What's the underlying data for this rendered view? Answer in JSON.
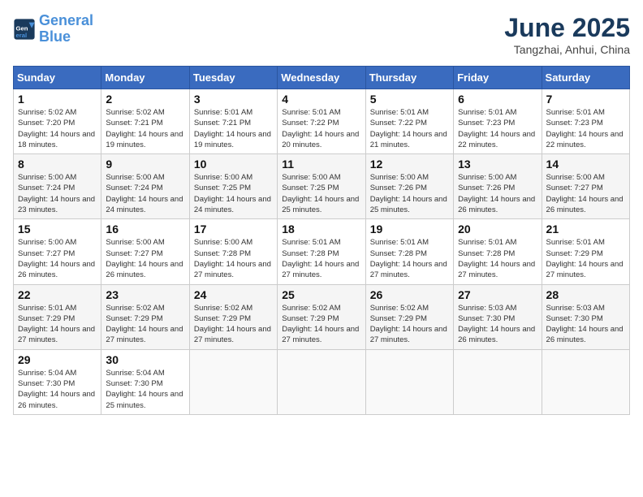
{
  "header": {
    "logo_line1": "General",
    "logo_line2": "Blue",
    "title": "June 2025",
    "subtitle": "Tangzhai, Anhui, China"
  },
  "calendar": {
    "days_of_week": [
      "Sunday",
      "Monday",
      "Tuesday",
      "Wednesday",
      "Thursday",
      "Friday",
      "Saturday"
    ],
    "weeks": [
      [
        {
          "day": null
        },
        {
          "day": "2",
          "sunrise": "5:02 AM",
          "sunset": "7:21 PM",
          "daylight": "14 hours and 19 minutes."
        },
        {
          "day": "3",
          "sunrise": "5:01 AM",
          "sunset": "7:21 PM",
          "daylight": "14 hours and 19 minutes."
        },
        {
          "day": "4",
          "sunrise": "5:01 AM",
          "sunset": "7:22 PM",
          "daylight": "14 hours and 20 minutes."
        },
        {
          "day": "5",
          "sunrise": "5:01 AM",
          "sunset": "7:22 PM",
          "daylight": "14 hours and 21 minutes."
        },
        {
          "day": "6",
          "sunrise": "5:01 AM",
          "sunset": "7:23 PM",
          "daylight": "14 hours and 22 minutes."
        },
        {
          "day": "7",
          "sunrise": "5:01 AM",
          "sunset": "7:23 PM",
          "daylight": "14 hours and 22 minutes."
        }
      ],
      [
        {
          "day": "1",
          "sunrise": "5:02 AM",
          "sunset": "7:20 PM",
          "daylight": "14 hours and 18 minutes."
        },
        null,
        null,
        null,
        null,
        null,
        null
      ],
      [
        {
          "day": "8",
          "sunrise": "5:00 AM",
          "sunset": "7:24 PM",
          "daylight": "14 hours and 23 minutes."
        },
        {
          "day": "9",
          "sunrise": "5:00 AM",
          "sunset": "7:24 PM",
          "daylight": "14 hours and 24 minutes."
        },
        {
          "day": "10",
          "sunrise": "5:00 AM",
          "sunset": "7:25 PM",
          "daylight": "14 hours and 24 minutes."
        },
        {
          "day": "11",
          "sunrise": "5:00 AM",
          "sunset": "7:25 PM",
          "daylight": "14 hours and 25 minutes."
        },
        {
          "day": "12",
          "sunrise": "5:00 AM",
          "sunset": "7:26 PM",
          "daylight": "14 hours and 25 minutes."
        },
        {
          "day": "13",
          "sunrise": "5:00 AM",
          "sunset": "7:26 PM",
          "daylight": "14 hours and 26 minutes."
        },
        {
          "day": "14",
          "sunrise": "5:00 AM",
          "sunset": "7:27 PM",
          "daylight": "14 hours and 26 minutes."
        }
      ],
      [
        {
          "day": "15",
          "sunrise": "5:00 AM",
          "sunset": "7:27 PM",
          "daylight": "14 hours and 26 minutes."
        },
        {
          "day": "16",
          "sunrise": "5:00 AM",
          "sunset": "7:27 PM",
          "daylight": "14 hours and 26 minutes."
        },
        {
          "day": "17",
          "sunrise": "5:00 AM",
          "sunset": "7:28 PM",
          "daylight": "14 hours and 27 minutes."
        },
        {
          "day": "18",
          "sunrise": "5:01 AM",
          "sunset": "7:28 PM",
          "daylight": "14 hours and 27 minutes."
        },
        {
          "day": "19",
          "sunrise": "5:01 AM",
          "sunset": "7:28 PM",
          "daylight": "14 hours and 27 minutes."
        },
        {
          "day": "20",
          "sunrise": "5:01 AM",
          "sunset": "7:28 PM",
          "daylight": "14 hours and 27 minutes."
        },
        {
          "day": "21",
          "sunrise": "5:01 AM",
          "sunset": "7:29 PM",
          "daylight": "14 hours and 27 minutes."
        }
      ],
      [
        {
          "day": "22",
          "sunrise": "5:01 AM",
          "sunset": "7:29 PM",
          "daylight": "14 hours and 27 minutes."
        },
        {
          "day": "23",
          "sunrise": "5:02 AM",
          "sunset": "7:29 PM",
          "daylight": "14 hours and 27 minutes."
        },
        {
          "day": "24",
          "sunrise": "5:02 AM",
          "sunset": "7:29 PM",
          "daylight": "14 hours and 27 minutes."
        },
        {
          "day": "25",
          "sunrise": "5:02 AM",
          "sunset": "7:29 PM",
          "daylight": "14 hours and 27 minutes."
        },
        {
          "day": "26",
          "sunrise": "5:02 AM",
          "sunset": "7:29 PM",
          "daylight": "14 hours and 27 minutes."
        },
        {
          "day": "27",
          "sunrise": "5:03 AM",
          "sunset": "7:30 PM",
          "daylight": "14 hours and 26 minutes."
        },
        {
          "day": "28",
          "sunrise": "5:03 AM",
          "sunset": "7:30 PM",
          "daylight": "14 hours and 26 minutes."
        }
      ],
      [
        {
          "day": "29",
          "sunrise": "5:04 AM",
          "sunset": "7:30 PM",
          "daylight": "14 hours and 26 minutes."
        },
        {
          "day": "30",
          "sunrise": "5:04 AM",
          "sunset": "7:30 PM",
          "daylight": "14 hours and 25 minutes."
        },
        {
          "day": null
        },
        {
          "day": null
        },
        {
          "day": null
        },
        {
          "day": null
        },
        {
          "day": null
        }
      ]
    ]
  }
}
